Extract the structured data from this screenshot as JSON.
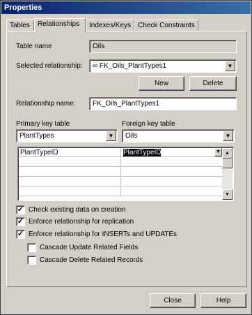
{
  "window": {
    "title": "Properties"
  },
  "tabs": [
    {
      "label": "Tables",
      "active": false
    },
    {
      "label": "Relationships",
      "active": true
    },
    {
      "label": "Indexes/Keys",
      "active": false
    },
    {
      "label": "Check Constraints",
      "active": false
    }
  ],
  "table_name": {
    "label": "Table name",
    "value": "Oils"
  },
  "selected_relationship": {
    "label": "Selected relationship:",
    "value": "∞ FK_Oils_PlantTypes1"
  },
  "buttons": {
    "new": "New",
    "delete": "Delete",
    "close": "Close",
    "help": "Help"
  },
  "relationship_name": {
    "label": "Relationship name:",
    "value": "FK_Oils_PlantTypes1"
  },
  "primary_key_table": {
    "label": "Primary key table",
    "value": "PlantTypes"
  },
  "foreign_key_table": {
    "label": "Foreign key table",
    "value": "Oils"
  },
  "column_grid": {
    "rows": [
      {
        "primary": "PlantTypeID",
        "foreign": "PlantTypeID"
      },
      {
        "primary": "",
        "foreign": ""
      },
      {
        "primary": "",
        "foreign": ""
      },
      {
        "primary": "",
        "foreign": ""
      },
      {
        "primary": "",
        "foreign": ""
      }
    ]
  },
  "options": {
    "check_existing": {
      "label": "Check existing data on creation",
      "checked": true
    },
    "enforce_replication": {
      "label": "Enforce relationship for replication",
      "checked": true
    },
    "enforce_inserts_updates": {
      "label": "Enforce relationship for INSERTs and UPDATEs",
      "checked": true
    },
    "cascade_update": {
      "label": "Cascade Update Related Fields",
      "checked": false
    },
    "cascade_delete": {
      "label": "Cascade Delete Related Records",
      "checked": false
    }
  }
}
